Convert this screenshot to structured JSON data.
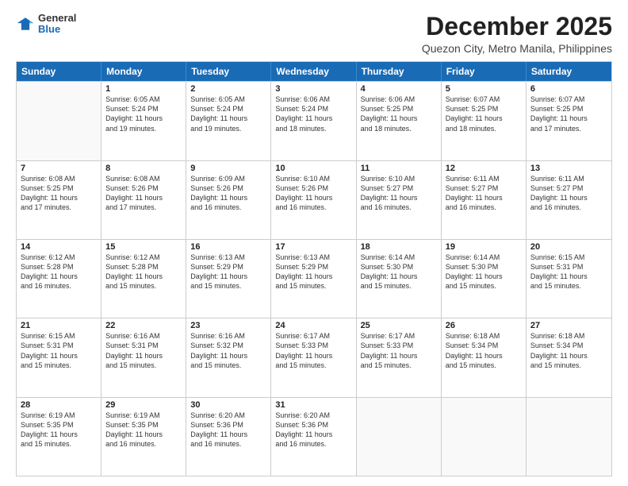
{
  "header": {
    "logo_general": "General",
    "logo_blue": "Blue",
    "month_title": "December 2025",
    "location": "Quezon City, Metro Manila, Philippines"
  },
  "weekdays": [
    "Sunday",
    "Monday",
    "Tuesday",
    "Wednesday",
    "Thursday",
    "Friday",
    "Saturday"
  ],
  "rows": [
    [
      {
        "day": "",
        "info": ""
      },
      {
        "day": "1",
        "info": "Sunrise: 6:05 AM\nSunset: 5:24 PM\nDaylight: 11 hours\nand 19 minutes."
      },
      {
        "day": "2",
        "info": "Sunrise: 6:05 AM\nSunset: 5:24 PM\nDaylight: 11 hours\nand 19 minutes."
      },
      {
        "day": "3",
        "info": "Sunrise: 6:06 AM\nSunset: 5:24 PM\nDaylight: 11 hours\nand 18 minutes."
      },
      {
        "day": "4",
        "info": "Sunrise: 6:06 AM\nSunset: 5:25 PM\nDaylight: 11 hours\nand 18 minutes."
      },
      {
        "day": "5",
        "info": "Sunrise: 6:07 AM\nSunset: 5:25 PM\nDaylight: 11 hours\nand 18 minutes."
      },
      {
        "day": "6",
        "info": "Sunrise: 6:07 AM\nSunset: 5:25 PM\nDaylight: 11 hours\nand 17 minutes."
      }
    ],
    [
      {
        "day": "7",
        "info": "Sunrise: 6:08 AM\nSunset: 5:25 PM\nDaylight: 11 hours\nand 17 minutes."
      },
      {
        "day": "8",
        "info": "Sunrise: 6:08 AM\nSunset: 5:26 PM\nDaylight: 11 hours\nand 17 minutes."
      },
      {
        "day": "9",
        "info": "Sunrise: 6:09 AM\nSunset: 5:26 PM\nDaylight: 11 hours\nand 16 minutes."
      },
      {
        "day": "10",
        "info": "Sunrise: 6:10 AM\nSunset: 5:26 PM\nDaylight: 11 hours\nand 16 minutes."
      },
      {
        "day": "11",
        "info": "Sunrise: 6:10 AM\nSunset: 5:27 PM\nDaylight: 11 hours\nand 16 minutes."
      },
      {
        "day": "12",
        "info": "Sunrise: 6:11 AM\nSunset: 5:27 PM\nDaylight: 11 hours\nand 16 minutes."
      },
      {
        "day": "13",
        "info": "Sunrise: 6:11 AM\nSunset: 5:27 PM\nDaylight: 11 hours\nand 16 minutes."
      }
    ],
    [
      {
        "day": "14",
        "info": "Sunrise: 6:12 AM\nSunset: 5:28 PM\nDaylight: 11 hours\nand 16 minutes."
      },
      {
        "day": "15",
        "info": "Sunrise: 6:12 AM\nSunset: 5:28 PM\nDaylight: 11 hours\nand 15 minutes."
      },
      {
        "day": "16",
        "info": "Sunrise: 6:13 AM\nSunset: 5:29 PM\nDaylight: 11 hours\nand 15 minutes."
      },
      {
        "day": "17",
        "info": "Sunrise: 6:13 AM\nSunset: 5:29 PM\nDaylight: 11 hours\nand 15 minutes."
      },
      {
        "day": "18",
        "info": "Sunrise: 6:14 AM\nSunset: 5:30 PM\nDaylight: 11 hours\nand 15 minutes."
      },
      {
        "day": "19",
        "info": "Sunrise: 6:14 AM\nSunset: 5:30 PM\nDaylight: 11 hours\nand 15 minutes."
      },
      {
        "day": "20",
        "info": "Sunrise: 6:15 AM\nSunset: 5:31 PM\nDaylight: 11 hours\nand 15 minutes."
      }
    ],
    [
      {
        "day": "21",
        "info": "Sunrise: 6:15 AM\nSunset: 5:31 PM\nDaylight: 11 hours\nand 15 minutes."
      },
      {
        "day": "22",
        "info": "Sunrise: 6:16 AM\nSunset: 5:31 PM\nDaylight: 11 hours\nand 15 minutes."
      },
      {
        "day": "23",
        "info": "Sunrise: 6:16 AM\nSunset: 5:32 PM\nDaylight: 11 hours\nand 15 minutes."
      },
      {
        "day": "24",
        "info": "Sunrise: 6:17 AM\nSunset: 5:33 PM\nDaylight: 11 hours\nand 15 minutes."
      },
      {
        "day": "25",
        "info": "Sunrise: 6:17 AM\nSunset: 5:33 PM\nDaylight: 11 hours\nand 15 minutes."
      },
      {
        "day": "26",
        "info": "Sunrise: 6:18 AM\nSunset: 5:34 PM\nDaylight: 11 hours\nand 15 minutes."
      },
      {
        "day": "27",
        "info": "Sunrise: 6:18 AM\nSunset: 5:34 PM\nDaylight: 11 hours\nand 15 minutes."
      }
    ],
    [
      {
        "day": "28",
        "info": "Sunrise: 6:19 AM\nSunset: 5:35 PM\nDaylight: 11 hours\nand 15 minutes."
      },
      {
        "day": "29",
        "info": "Sunrise: 6:19 AM\nSunset: 5:35 PM\nDaylight: 11 hours\nand 16 minutes."
      },
      {
        "day": "30",
        "info": "Sunrise: 6:20 AM\nSunset: 5:36 PM\nDaylight: 11 hours\nand 16 minutes."
      },
      {
        "day": "31",
        "info": "Sunrise: 6:20 AM\nSunset: 5:36 PM\nDaylight: 11 hours\nand 16 minutes."
      },
      {
        "day": "",
        "info": ""
      },
      {
        "day": "",
        "info": ""
      },
      {
        "day": "",
        "info": ""
      }
    ]
  ]
}
